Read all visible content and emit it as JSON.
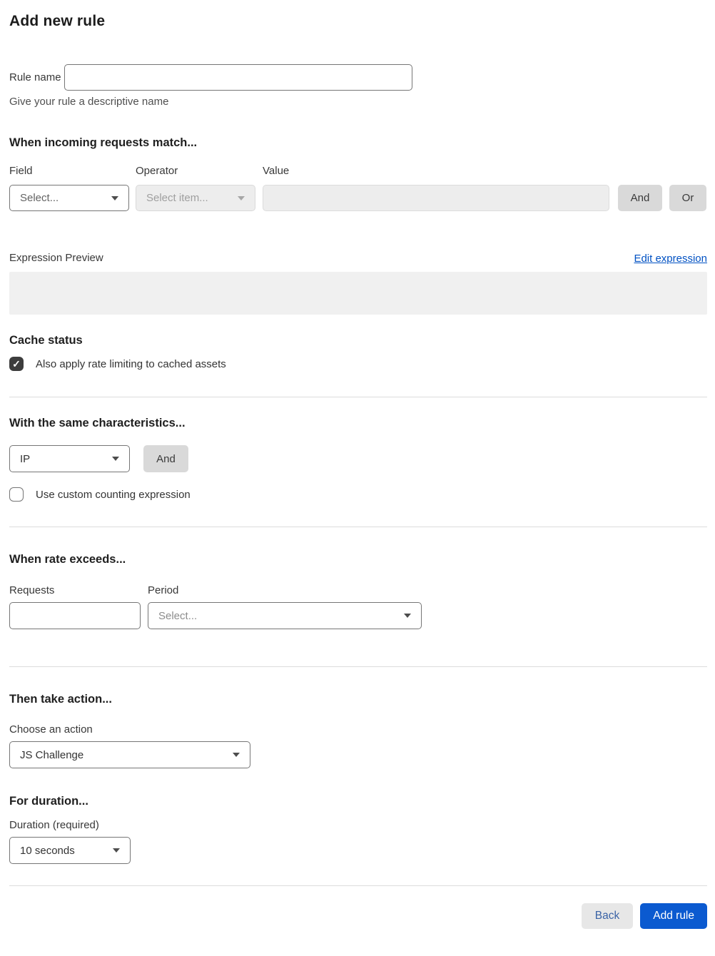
{
  "page": {
    "title": "Add new rule"
  },
  "rule_name": {
    "label": "Rule name",
    "value": "",
    "helper": "Give your rule a descriptive name"
  },
  "match_section": {
    "heading": "When incoming requests match...",
    "field": {
      "label": "Field",
      "selected": "Select..."
    },
    "operator": {
      "label": "Operator",
      "selected": "Select item..."
    },
    "value": {
      "label": "Value",
      "value": ""
    },
    "and_label": "And",
    "or_label": "Or",
    "expression_preview_label": "Expression Preview",
    "edit_expression_label": "Edit expression",
    "expression_value": ""
  },
  "cache_status": {
    "heading": "Cache status",
    "checkbox_label": "Also apply rate limiting to cached assets",
    "checked": true
  },
  "characteristics": {
    "heading": "With the same characteristics...",
    "select_value": "IP",
    "and_label": "And",
    "checkbox_label": "Use custom counting expression",
    "checked": false
  },
  "rate": {
    "heading": "When rate exceeds...",
    "requests_label": "Requests",
    "requests_value": "",
    "period_label": "Period",
    "period_selected": "Select..."
  },
  "action": {
    "heading": "Then take action...",
    "label": "Choose an action",
    "selected": "JS Challenge"
  },
  "duration": {
    "heading": "For duration...",
    "label": "Duration (required)",
    "selected": "10 seconds"
  },
  "footer": {
    "back_label": "Back",
    "add_label": "Add rule"
  },
  "colors": {
    "primary_blue": "#0b5ad0",
    "link_blue": "#0051c3",
    "checkbox_checked": "#3d3d3d",
    "disabled_bg": "#ededed",
    "button_gray": "#d9d9d9"
  },
  "icons": {
    "checkmark": "✓",
    "dropdown_caret": "chevron-down"
  }
}
